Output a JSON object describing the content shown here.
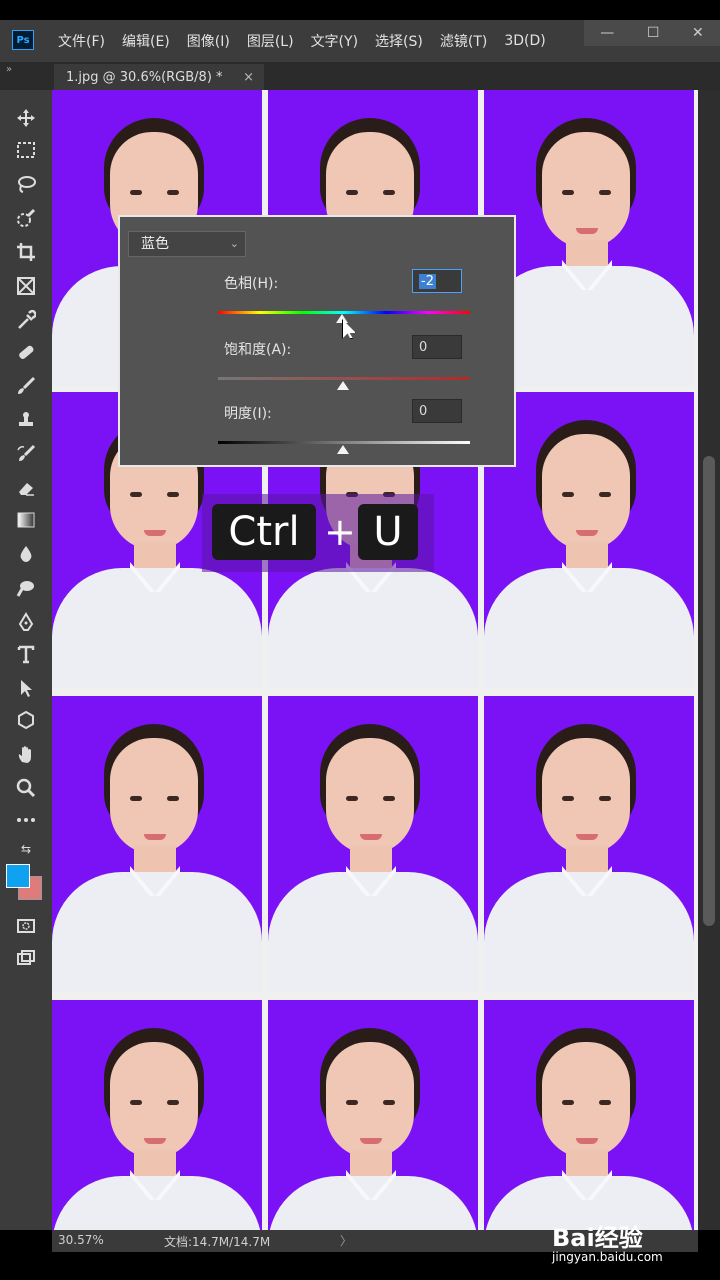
{
  "app": {
    "logo": "Ps"
  },
  "menu": [
    "文件(F)",
    "编辑(E)",
    "图像(I)",
    "图层(L)",
    "文字(Y)",
    "选择(S)",
    "滤镜(T)",
    "3D(D)"
  ],
  "window_controls": {
    "minimize": "—",
    "restore": "☐",
    "close": "✕"
  },
  "document_tab": {
    "title": "1.jpg @ 30.6%(RGB/8) *",
    "close": "×"
  },
  "collapse_glyph": "»",
  "tools": [
    "move-icon",
    "marquee-icon",
    "lasso-icon",
    "quick-select-icon",
    "crop-icon",
    "frame-icon",
    "eyedropper-icon",
    "healing-brush-icon",
    "brush-icon",
    "clone-stamp-icon",
    "history-brush-icon",
    "eraser-icon",
    "gradient-icon",
    "blur-icon",
    "dodge-icon",
    "pen-icon",
    "type-icon",
    "path-select-icon",
    "shape-icon",
    "hand-icon",
    "zoom-icon",
    "more-tools-icon"
  ],
  "colors": {
    "foreground": "#0ea2f0",
    "background": "#e07b7b",
    "photo_bg": "#7a12f5"
  },
  "hue_sat_panel": {
    "channel": "蓝色",
    "hue": {
      "label": "色相(H):",
      "value": "-2"
    },
    "saturation": {
      "label": "饱和度(A):",
      "value": "0"
    },
    "lightness": {
      "label": "明度(I):",
      "value": "0"
    }
  },
  "shortcut": {
    "key1": "Ctrl",
    "plus": "+",
    "key2": "U"
  },
  "status": {
    "zoom": "30.57%",
    "doc": "文档:14.7M/14.7M",
    "arrow": "〉"
  },
  "watermark": {
    "brand": "Bai经验",
    "url": "jingyan.baidu.com"
  }
}
